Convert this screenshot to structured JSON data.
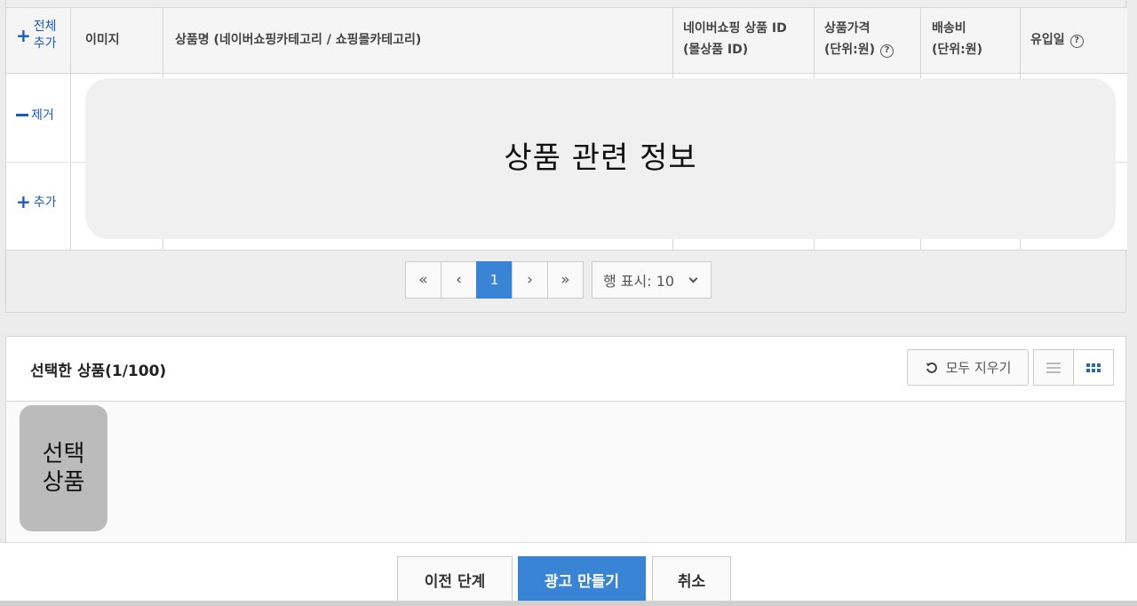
{
  "table": {
    "header": {
      "add_all": [
        "전체",
        "추가"
      ],
      "image": "이미지",
      "name": "상품명 (네이버쇼핑카테고리 / 쇼핑몰카테고리)",
      "product_id": [
        "네이버쇼핑 상품 ID",
        "(몰상품 ID)"
      ],
      "price": [
        "상품가격",
        "(단위:원)"
      ],
      "shipping": [
        "배송비",
        "(단위:원)"
      ],
      "inflow_date": "유입일",
      "help_glyph": "?"
    },
    "rows": [
      {
        "action_label": "제거",
        "action": "remove"
      },
      {
        "action_label": "추가",
        "action": "add"
      }
    ],
    "overlay_text": "상품 관련 정보"
  },
  "pagination": {
    "first": "«",
    "prev": "‹",
    "current_page": "1",
    "next": "›",
    "last": "»",
    "rows_per_page_label": "행 표시: 10"
  },
  "selected": {
    "title": "선택한 상품(1/100)",
    "clear_all_label": "모두 지우기",
    "thumb_text": [
      "선택",
      "상품"
    ]
  },
  "footer": {
    "prev_step": "이전 단계",
    "create_ad": "광고 만들기",
    "cancel": "취소"
  },
  "colors": {
    "accent": "#3a84d6",
    "link_blue": "#1b5bb8"
  },
  "icons": {
    "refresh": "refresh-icon",
    "list_view": "list-view-icon",
    "grid_view": "grid-view-icon"
  }
}
